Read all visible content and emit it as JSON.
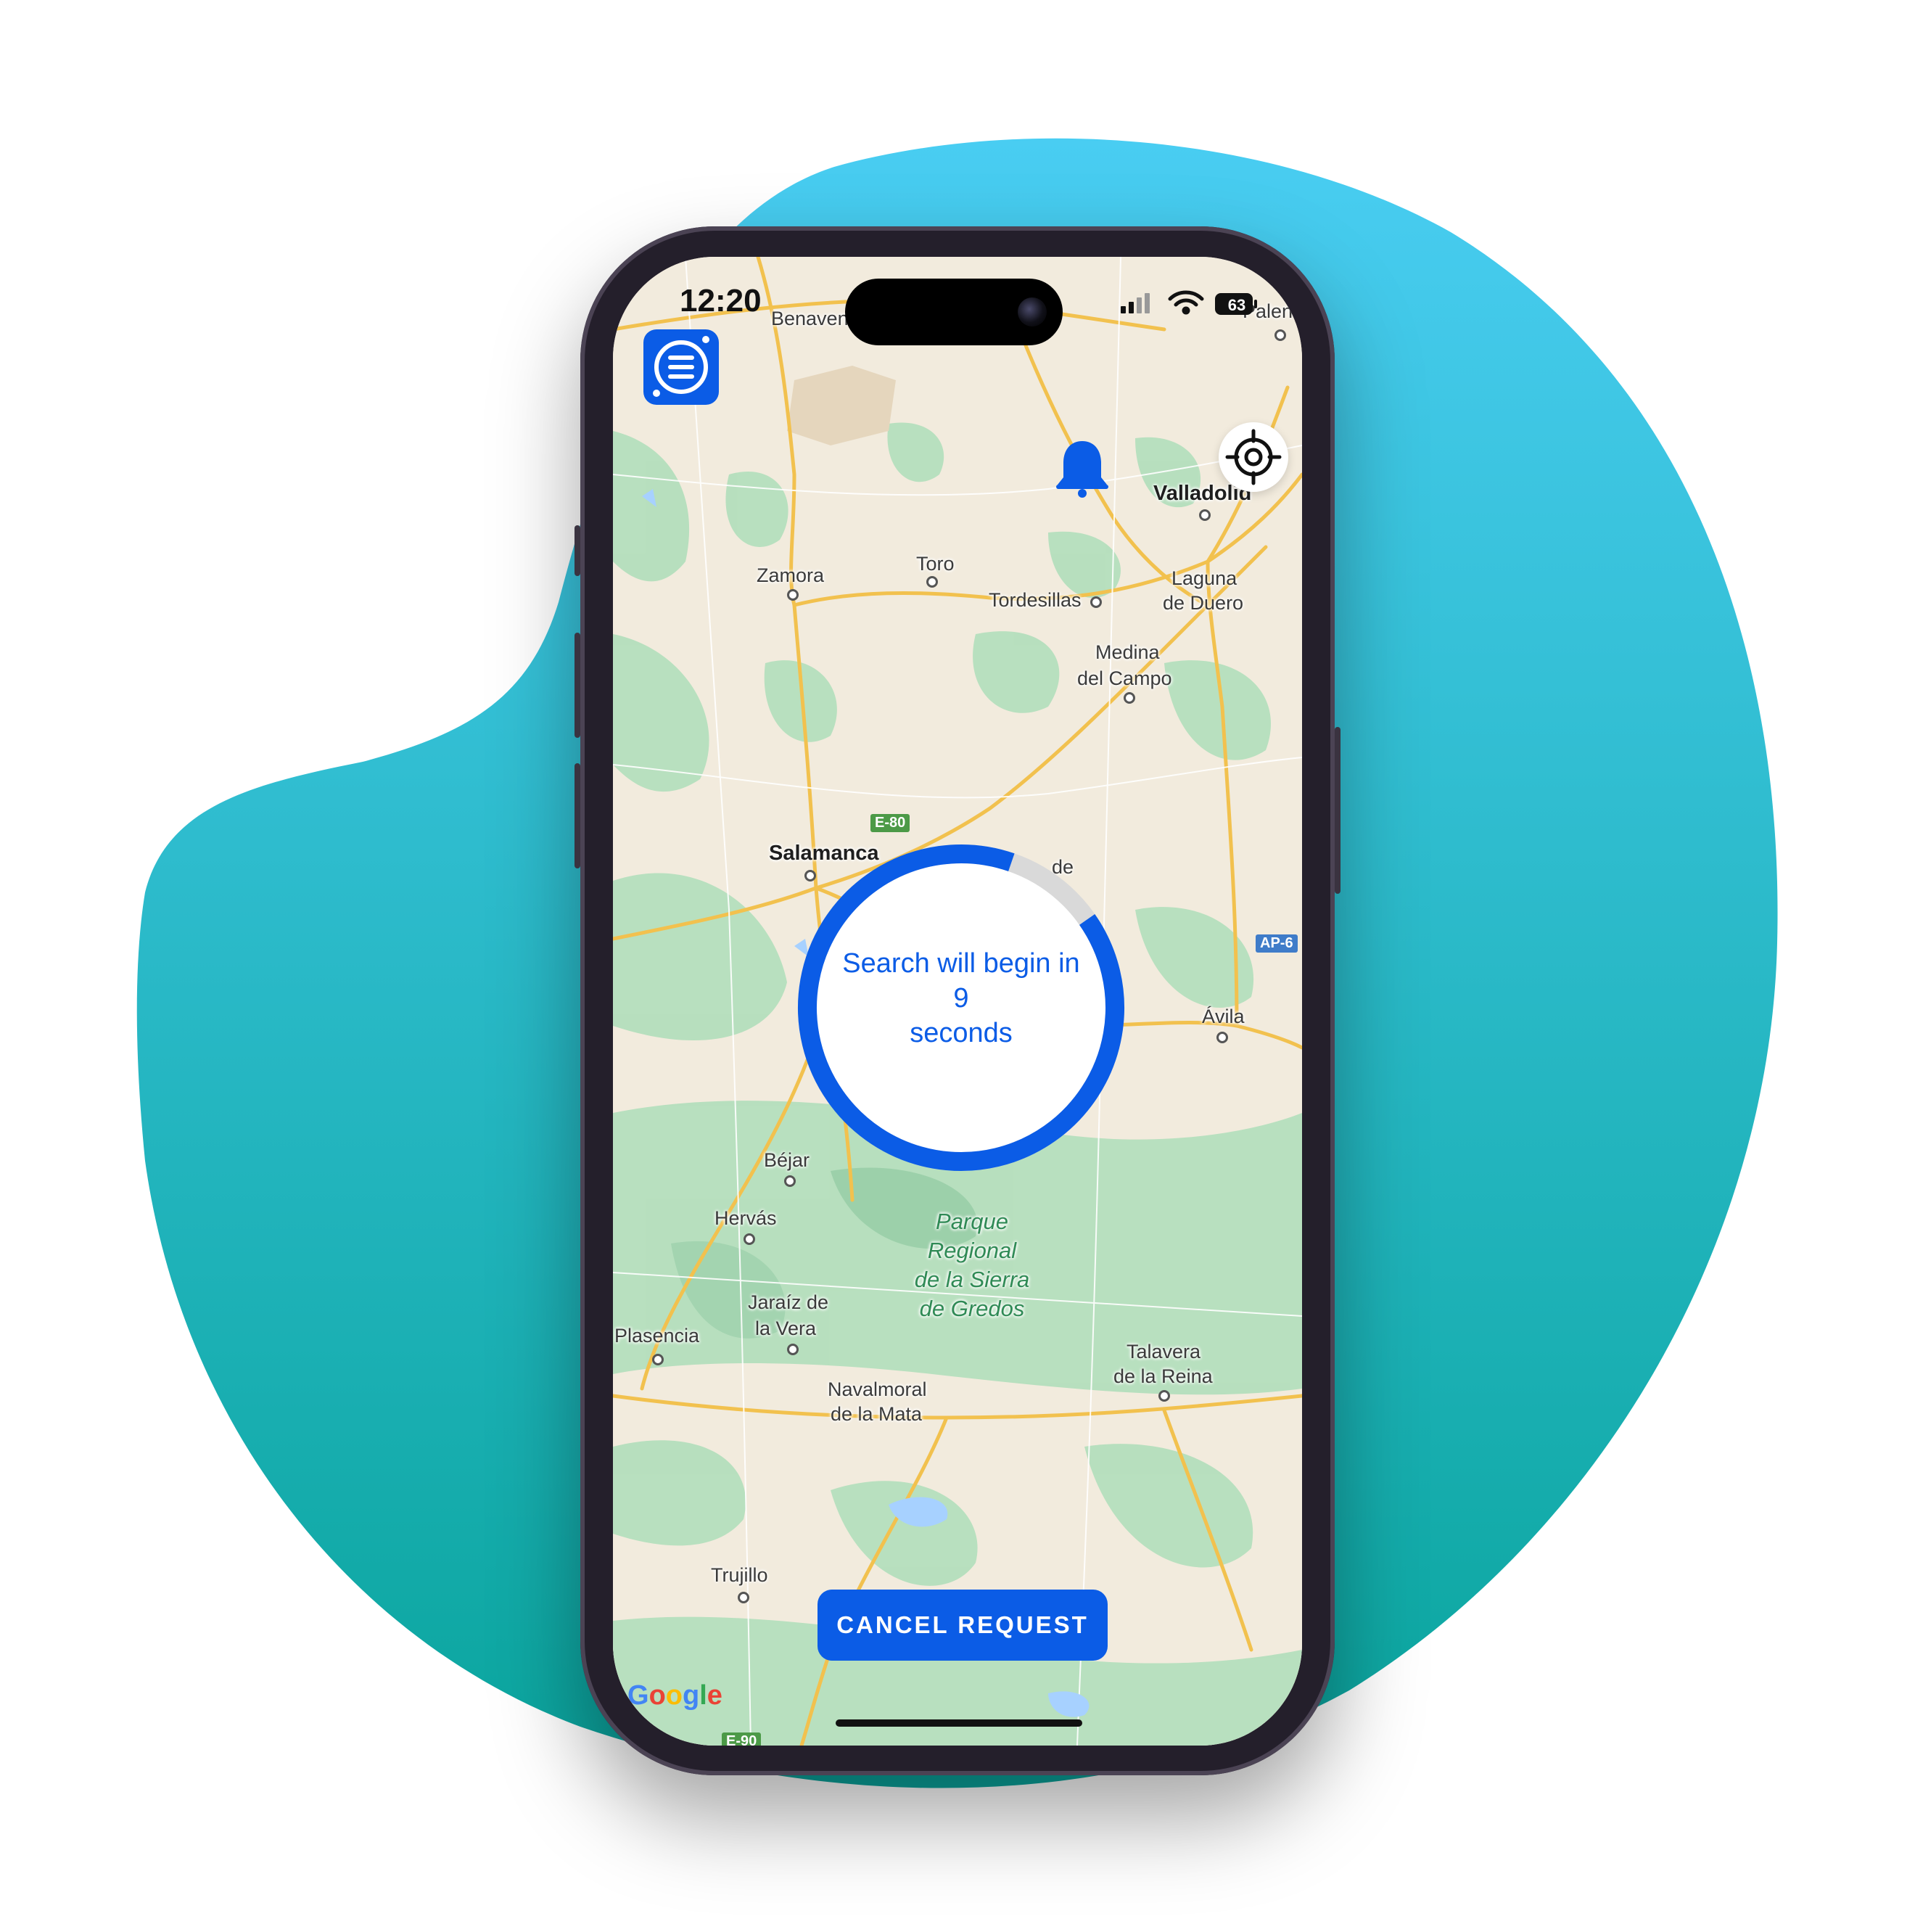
{
  "status_bar": {
    "time": "12:20",
    "battery": "63",
    "icons": [
      "cellular-signal-icon",
      "wifi-icon",
      "battery-icon"
    ]
  },
  "toolbar": {
    "menu_icon": "menu-list-icon",
    "notification_icon": "bell-icon",
    "locate_icon": "crosshair-icon"
  },
  "map": {
    "provider_logo": "Google",
    "places": [
      {
        "id": "benavente",
        "label": "Benaven"
      },
      {
        "id": "palencia",
        "label": "Palen"
      },
      {
        "id": "valladolid",
        "label": "Valladolid"
      },
      {
        "id": "zamora",
        "label": "Zamora"
      },
      {
        "id": "toro",
        "label": "Toro"
      },
      {
        "id": "tordesillas",
        "label": "Tordesillas"
      },
      {
        "id": "laguna-line1",
        "label": "Laguna"
      },
      {
        "id": "laguna-line2",
        "label": "de Duero"
      },
      {
        "id": "medina-line1",
        "label": "Medina"
      },
      {
        "id": "medina-line2",
        "label": "del Campo"
      },
      {
        "id": "salamanca",
        "label": "Salamanca"
      },
      {
        "id": "partial-de",
        "label": "de"
      },
      {
        "id": "avila",
        "label": "Ávila"
      },
      {
        "id": "bejar",
        "label": "Béjar"
      },
      {
        "id": "hervas",
        "label": "Hervás"
      },
      {
        "id": "jaraiz-line1",
        "label": "Jaraíz de"
      },
      {
        "id": "jaraiz-line2",
        "label": "la Vera"
      },
      {
        "id": "plasencia",
        "label": "Plasencia"
      },
      {
        "id": "navalmoral-line1",
        "label": "Navalmoral"
      },
      {
        "id": "navalmoral-line2",
        "label": "de la Mata"
      },
      {
        "id": "talavera-line1",
        "label": "Talavera"
      },
      {
        "id": "talavera-line2",
        "label": "de la Reina"
      },
      {
        "id": "trujillo",
        "label": "Trujillo"
      }
    ],
    "park": [
      "Parque",
      "Regional",
      "de la Sierra",
      "de Gredos"
    ],
    "road_shields": [
      {
        "label": "E-80",
        "color": "#4c9a47"
      },
      {
        "label": "AP-6",
        "color": "#3f7cc9"
      },
      {
        "label": "E-90",
        "color": "#4c9a47"
      }
    ]
  },
  "countdown": {
    "line1": "Search will begin in",
    "seconds": "9",
    "line3": "seconds",
    "progress": 0.9
  },
  "actions": {
    "cancel_label": "CANCEL REQUEST"
  },
  "colors": {
    "accent": "#0b5ce6",
    "ring_track": "#d9d9d9",
    "backdrop_top": "#49cdf2",
    "backdrop_bottom": "#0aa59d"
  }
}
